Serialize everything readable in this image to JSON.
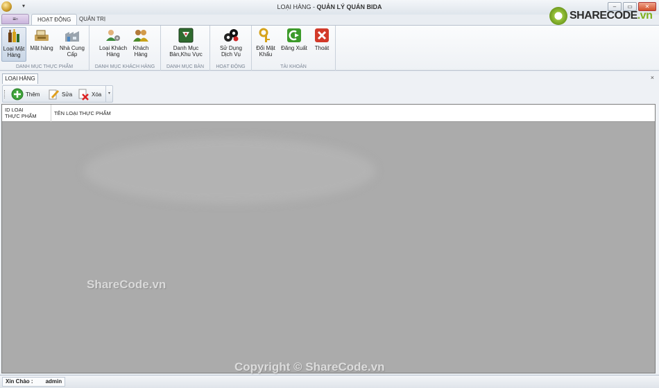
{
  "window": {
    "title_prefix": "LOẠI HÀNG - ",
    "title_app": "QUẢN LÝ QUÁN BIDA",
    "qat_arrow": "▾",
    "buttons": {
      "minimize": "–",
      "restore": "▭",
      "close": "✕"
    }
  },
  "logo": {
    "text_brand": "SHARECODE",
    "text_tld": ".vn"
  },
  "ribbon": {
    "app_button": "≡▫",
    "tabs": [
      {
        "label": "HOẠT ĐỘNG",
        "active": true
      },
      {
        "label": "QUẢN TRỊ",
        "active": false
      }
    ],
    "groups": [
      {
        "label": "DANH MỤC THỰC PHẨM",
        "buttons": [
          {
            "line1": "Loại Mặt",
            "line2": "Hàng",
            "icon": "bottles-icon",
            "selected": true
          },
          {
            "line1": "Mặt hàng",
            "line2": "",
            "icon": "cash-register-icon"
          },
          {
            "line1": "Nhà Cung",
            "line2": "Cấp",
            "icon": "factory-icon"
          }
        ]
      },
      {
        "label": "DANH MỤC KHÁCH HÀNG",
        "buttons": [
          {
            "line1": "Loại Khách",
            "line2": "Hàng",
            "icon": "user-settings-icon"
          },
          {
            "line1": "Khách",
            "line2": "Hàng",
            "icon": "users-icon"
          }
        ]
      },
      {
        "label": "DANH MỤC BÀN",
        "buttons": [
          {
            "line1": "Danh Mục",
            "line2": "Bàn,Khu Vực",
            "icon": "billiard-rack-icon"
          }
        ]
      },
      {
        "label": "HOẠT ĐỘNG",
        "buttons": [
          {
            "line1": "Sử Dụng",
            "line2": "Dịch Vụ",
            "icon": "billiard-balls-icon"
          }
        ]
      },
      {
        "label": "TÀI KHOẢN",
        "buttons": [
          {
            "line1": "Đổi Mật",
            "line2": "Khẩu",
            "icon": "keys-icon"
          },
          {
            "line1": "Đăng Xuất",
            "line2": "",
            "icon": "logout-icon"
          },
          {
            "line1": "Thoát",
            "line2": "",
            "icon": "exit-icon"
          }
        ]
      }
    ]
  },
  "document": {
    "tab_label": "LOẠI HÀNG",
    "close_glyph": "×",
    "toolbar": {
      "add": "Thêm",
      "edit": "Sửa",
      "delete": "Xóa",
      "dropdown": "▾"
    },
    "columns": [
      {
        "line1": "ID LOẠI",
        "line2": "THỰC PHẨM"
      },
      {
        "line1": "TÊN LOẠI THỰC PHẨM",
        "line2": ""
      }
    ]
  },
  "watermarks": {
    "center": "ShareCode.vn",
    "bottom": "Copyright © ShareCode.vn"
  },
  "status": {
    "greeting": "Xin Chào :",
    "user": "admin"
  },
  "colors": {
    "ribbon_bg": "#fbfcfd",
    "grid_bg": "#ababab",
    "logo_green": "#7fb01f"
  }
}
